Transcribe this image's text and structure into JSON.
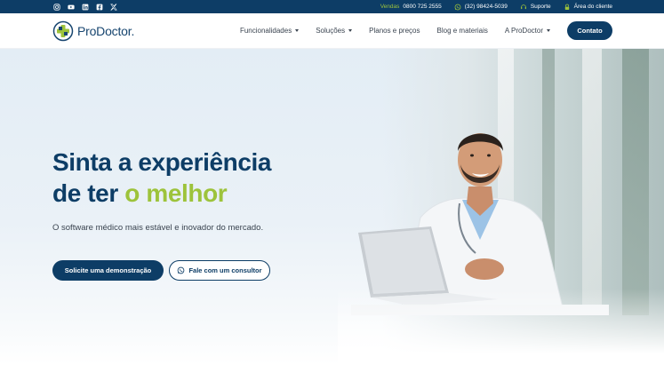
{
  "topbar": {
    "social": [
      "instagram-icon",
      "youtube-icon",
      "linkedin-icon",
      "facebook-icon",
      "x-icon"
    ],
    "vendas_label": "Vendas",
    "vendas_phone": "0800 725 2555",
    "whatsapp_phone": "(32) 98424-5039",
    "suporte": "Suporte",
    "area_cliente": "Área do cliente"
  },
  "header": {
    "logo_text": "ProDoctor",
    "logo_dot": ".",
    "nav": {
      "funcionalidades": "Funcionalidades",
      "solucoes": "Soluções",
      "planos": "Planos e preços",
      "blog": "Blog e materiais",
      "prodoctor": "A ProDoctor"
    },
    "contato": "Contato"
  },
  "hero": {
    "headline_line1": "Sinta a experiência",
    "headline_line2_a": "de ter ",
    "headline_line2_b": "o melhor",
    "subtitle": "O software médico mais estável e inovador do mercado.",
    "btn_demo": "Solicite uma demonstração",
    "btn_consultor": "Fale com um consultor"
  },
  "colors": {
    "navy": "#0d3d66",
    "green": "#9dc33b",
    "text": "#3a4450"
  }
}
